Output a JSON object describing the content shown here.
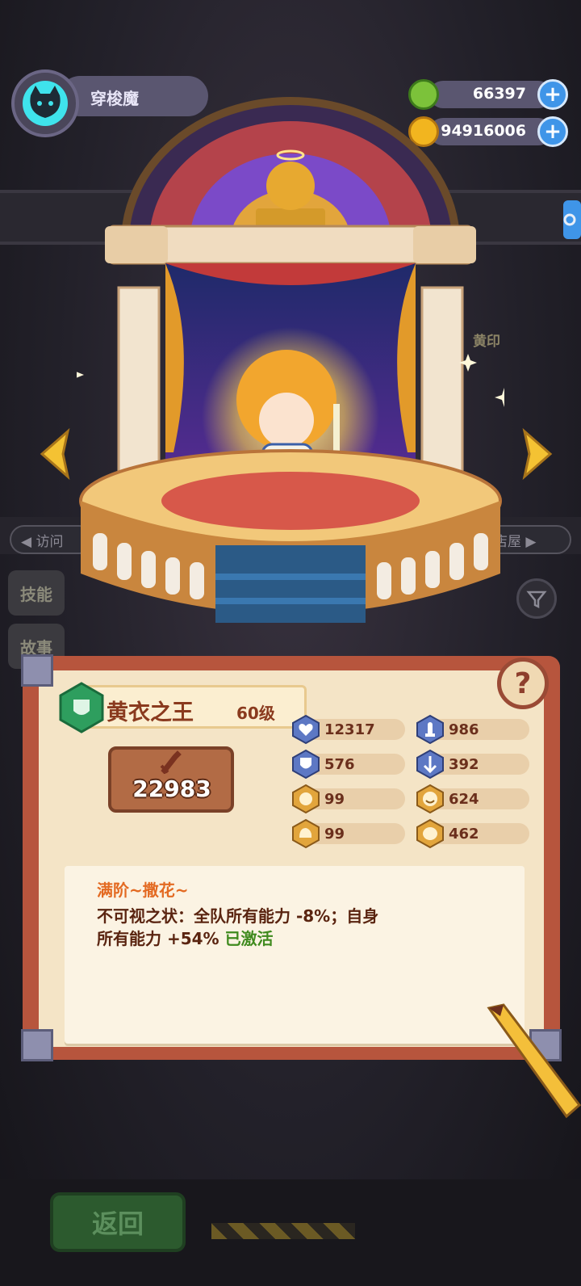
{
  "player": {
    "name": "穿梭魔"
  },
  "currencies": [
    {
      "icon": "green-gem-coin-icon",
      "value": "66397"
    },
    {
      "icon": "gold-planet-coin-icon",
      "value": "94916006"
    }
  ],
  "background": {
    "tabs": [
      "技能",
      "故事"
    ],
    "bg_label_left": "◀ 访问",
    "bg_label_right": "店屋 ▶",
    "bg_label_seal": "黄印",
    "back_label": "返回"
  },
  "hero": {
    "name": "黄衣之王",
    "level": "60级",
    "power": "22983",
    "stats": [
      {
        "icon": "heart-icon",
        "value": "12317"
      },
      {
        "icon": "attack-icon",
        "value": "986"
      },
      {
        "icon": "shield-icon",
        "value": "576"
      },
      {
        "icon": "speed-icon",
        "value": "392"
      },
      {
        "icon": "charm-icon",
        "value": "99"
      },
      {
        "icon": "luck-icon",
        "value": "624"
      },
      {
        "icon": "strength-icon",
        "value": "99"
      },
      {
        "icon": "intellect-icon",
        "value": "462"
      }
    ]
  },
  "skill": {
    "title": "满阶~撒花~",
    "line1": "不可视之状：全队所有能力 -8%；自身",
    "line2_prefix": "所有能力 +54% ",
    "line2_active": "已激活"
  },
  "colors": {
    "accent_blue": "#3f95e8",
    "card_red": "#b7553d",
    "parchment": "#f4e4c6",
    "active_green": "#3f8a1e"
  }
}
